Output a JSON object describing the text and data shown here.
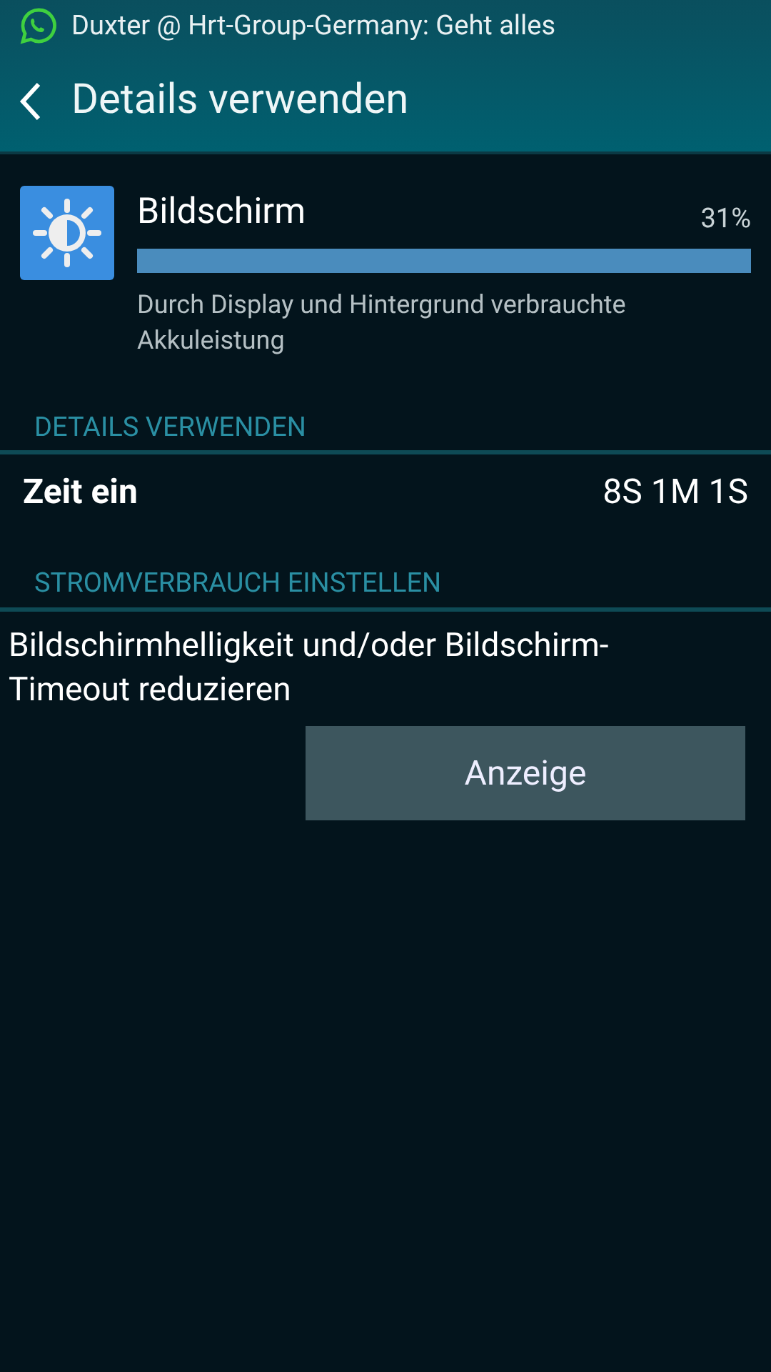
{
  "notification": {
    "text": "Duxter @ Hrt-Group-Germany: Geht alles"
  },
  "action_bar": {
    "title": "Details verwenden"
  },
  "usage_item": {
    "name": "Bildschirm",
    "percent": "31%",
    "level": 1,
    "description": "Durch Display und Hintergrund verbrauchte Akkuleistung"
  },
  "sections": [
    {
      "header": "DETAILS VERWENDEN",
      "kind": "detail",
      "label": "Zeit ein",
      "value": "8S 1M 1S"
    },
    {
      "header": "STROMVERBRAUCH EINSTELLEN",
      "kind": "tip",
      "text": "Bildschirmhelligkeit und/oder Bildschirm-Timeout reduzieren",
      "button": "Anzeige"
    }
  ]
}
